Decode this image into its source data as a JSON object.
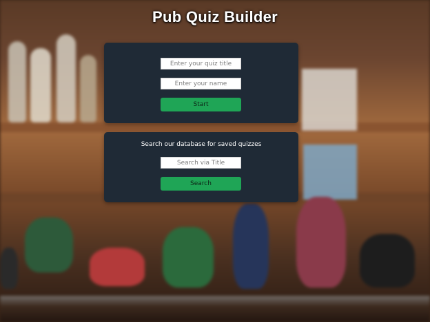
{
  "app": {
    "title": "Pub Quiz Builder"
  },
  "create_panel": {
    "quiz_title_placeholder": "Enter your quiz title",
    "name_placeholder": "Enter your name",
    "start_label": "Start"
  },
  "search_panel": {
    "heading": "Search our database for saved quizzes",
    "search_placeholder": "Search via Title",
    "search_label": "Search"
  },
  "colors": {
    "panel_bg": "#1f2a36",
    "button_bg": "#1fa556",
    "title_text": "#ffffff"
  }
}
